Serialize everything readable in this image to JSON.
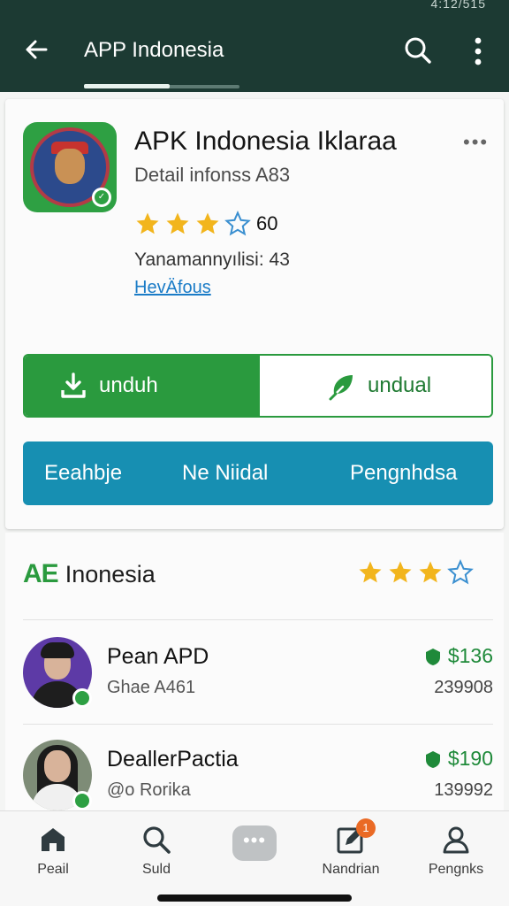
{
  "status_bar": {
    "text": "4:12/515"
  },
  "app_bar": {
    "title": "APP Indonesia",
    "tab_progress": 0.55
  },
  "app": {
    "name": "APK Indonesia Iklaraa",
    "subtitle": "Detail infonss A83",
    "rating_stars": 3,
    "rating_max": 4,
    "rating_count": "60",
    "meta_line": "Yanamannyılisi: 43",
    "link": "HevÄfous"
  },
  "actions": {
    "primary_label": "unduh",
    "secondary_label": "undual"
  },
  "segments": [
    "Eeahbje",
    "Ne Niidal",
    "Pengnhdsa"
  ],
  "section": {
    "brand": "AE",
    "title": "Inonesia",
    "stars": 3,
    "stars_max": 4
  },
  "list": [
    {
      "name": "Pean APD",
      "handle": "Ghae A461",
      "price": "$136",
      "count": "239908"
    },
    {
      "name": "DeallerPactia",
      "handle": "@o Rorika",
      "price": "$190",
      "count": "139992"
    }
  ],
  "bottom_nav": [
    {
      "label": "Peail",
      "icon": "home-icon"
    },
    {
      "label": "Suld",
      "icon": "search-icon"
    },
    {
      "label": "•••",
      "icon": "more-icon"
    },
    {
      "label": "Nandrian",
      "icon": "edit-icon",
      "badge": "1"
    },
    {
      "label": "Pengnks",
      "icon": "person-icon"
    }
  ],
  "colors": {
    "app_bar": "#1c3a33",
    "accent_green": "#2a9a3e",
    "segment_blue": "#178fb2",
    "link_blue": "#1b7cc7",
    "star": "#f2b51d"
  }
}
